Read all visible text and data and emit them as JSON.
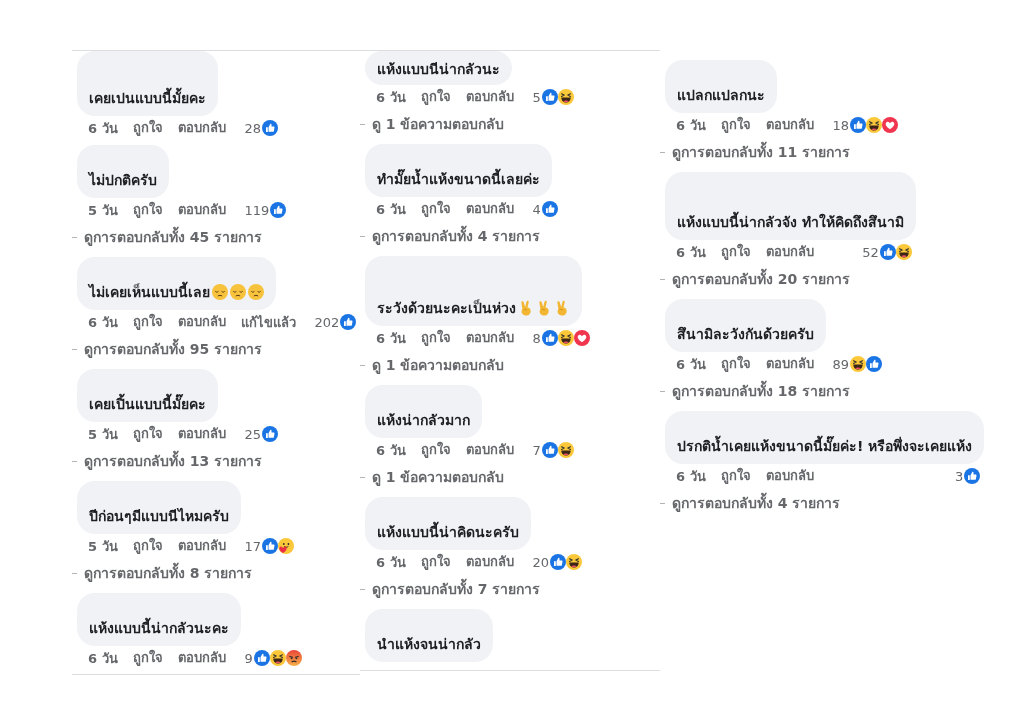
{
  "columns": [
    {
      "comments": [
        {
          "text": "เคยเปนแบบนี้มั้ยคะ",
          "time": "6 วัน",
          "like_label": "ถูกใจ",
          "reply_label": "ตอบกลับ",
          "reaction_count": "28",
          "reactions": [
            {
              "kind": "like"
            }
          ]
        },
        {
          "text": "ไม่ปกติครับ",
          "time": "5 วัน",
          "like_label": "ถูกใจ",
          "reply_label": "ตอบกลับ",
          "reaction_count": "119",
          "reactions": [
            {
              "kind": "like"
            }
          ],
          "view_replies": "ดูการตอบกลับทั้ง 45 รายการ"
        },
        {
          "text": "ไม่เคยเห็นแบบนี้เลย",
          "emoji": [
            {
              "kind": "pensive"
            },
            {
              "kind": "pensive"
            },
            {
              "kind": "pensive"
            }
          ],
          "time": "6 วัน",
          "like_label": "ถูกใจ",
          "reply_label": "ตอบกลับ",
          "edited_label": "แก้ไขแล้ว",
          "reaction_count": "202",
          "reactions": [
            {
              "kind": "like"
            }
          ],
          "view_replies": "ดูการตอบกลับทั้ง 95 รายการ"
        },
        {
          "text": "เคยเปิ้นแบบนี้มั๊ยคะ",
          "time": "5 วัน",
          "like_label": "ถูกใจ",
          "reply_label": "ตอบกลับ",
          "reaction_count": "25",
          "reactions": [
            {
              "kind": "like"
            }
          ],
          "view_replies": "ดูการตอบกลับทั้ง 13 รายการ"
        },
        {
          "text": "ปีก่อนๆมีแบบนีไหมครับ",
          "time": "5 วัน",
          "like_label": "ถูกใจ",
          "reply_label": "ตอบกลับ",
          "reaction_count": "17",
          "reactions": [
            {
              "kind": "like"
            },
            {
              "kind": "care"
            }
          ],
          "view_replies": "ดูการตอบกลับทั้ง 8 รายการ"
        },
        {
          "text": "แห้งแบบนี้น่ากลัวนะคะ",
          "time": "6 วัน",
          "like_label": "ถูกใจ",
          "reply_label": "ตอบกลับ",
          "reaction_count": "9",
          "reactions": [
            {
              "kind": "like"
            },
            {
              "kind": "haha"
            },
            {
              "kind": "angry"
            }
          ]
        }
      ]
    },
    {
      "comments": [
        {
          "text": "แห้งแบบนีน่ากลัวนะ",
          "time": "6 วัน",
          "like_label": "ถูกใจ",
          "reply_label": "ตอบกลับ",
          "reaction_count": "5",
          "reactions": [
            {
              "kind": "like"
            },
            {
              "kind": "haha"
            }
          ],
          "view_replies": "ดู 1 ข้อความตอบกลับ"
        },
        {
          "text": "ทำมั๊ยน้ำแห้งขนาดนี้เลยค่ะ",
          "time": "6 วัน",
          "like_label": "ถูกใจ",
          "reply_label": "ตอบกลับ",
          "reaction_count": "4",
          "reactions": [
            {
              "kind": "like"
            }
          ],
          "view_replies": "ดูการตอบกลับทั้ง 4 รายการ"
        },
        {
          "text": "ระวังด้วยนะคะเป็นห่วง",
          "emoji": [
            {
              "kind": "victory"
            },
            {
              "kind": "victory"
            },
            {
              "kind": "victory"
            }
          ],
          "time": "6 วัน",
          "like_label": "ถูกใจ",
          "reply_label": "ตอบกลับ",
          "reaction_count": "8",
          "reactions": [
            {
              "kind": "like"
            },
            {
              "kind": "haha"
            },
            {
              "kind": "love"
            }
          ],
          "view_replies": "ดู 1 ข้อความตอบกลับ"
        },
        {
          "text": "แห้งน่ากลัวมาก",
          "time": "6 วัน",
          "like_label": "ถูกใจ",
          "reply_label": "ตอบกลับ",
          "reaction_count": "7",
          "reactions": [
            {
              "kind": "like"
            },
            {
              "kind": "haha"
            }
          ],
          "view_replies": "ดู 1 ข้อความตอบกลับ"
        },
        {
          "text": "แห้งแบบนี้น่าคิดนะครับ",
          "time": "6 วัน",
          "like_label": "ถูกใจ",
          "reply_label": "ตอบกลับ",
          "reaction_count": "20",
          "reactions": [
            {
              "kind": "like"
            },
            {
              "kind": "haha"
            }
          ],
          "view_replies": "ดูการตอบกลับทั้ง 7 รายการ"
        },
        {
          "text": "นำแห้งจนน่ากลัว"
        }
      ]
    },
    {
      "comments": [
        {
          "text": "แปลกแปลกนะ",
          "time": "6 วัน",
          "like_label": "ถูกใจ",
          "reply_label": "ตอบกลับ",
          "reaction_count": "18",
          "reactions": [
            {
              "kind": "like"
            },
            {
              "kind": "haha"
            },
            {
              "kind": "love"
            }
          ],
          "view_replies": "ดูการตอบกลับทั้ง 11 รายการ"
        },
        {
          "text": "แห้งแบบนี้น่ากลัวจัง ทำให้คิดถึงสึนามิ",
          "time": "6 วัน",
          "like_label": "ถูกใจ",
          "reply_label": "ตอบกลับ",
          "reaction_count": "52",
          "reactions": [
            {
              "kind": "like"
            },
            {
              "kind": "haha"
            }
          ],
          "view_replies": "ดูการตอบกลับทั้ง 20 รายการ"
        },
        {
          "text": "สึนามิละวังกันด้วยครับ",
          "time": "6 วัน",
          "like_label": "ถูกใจ",
          "reply_label": "ตอบกลับ",
          "reaction_count": "89",
          "reactions": [
            {
              "kind": "haha"
            },
            {
              "kind": "like"
            }
          ],
          "view_replies": "ดูการตอบกลับทั้ง 18 รายการ"
        },
        {
          "text": "ปรกติน้ำเคยแห้งขนาดนี้มั๊ยค่ะ! หรือพึ่งจะเคยแห้ง",
          "time": "6 วัน",
          "like_label": "ถูกใจ",
          "reply_label": "ตอบกลับ",
          "reaction_count": "3",
          "reactions": [
            {
              "kind": "like"
            }
          ],
          "view_replies": "ดูการตอบกลับทั้ง 4 รายการ"
        }
      ]
    }
  ]
}
